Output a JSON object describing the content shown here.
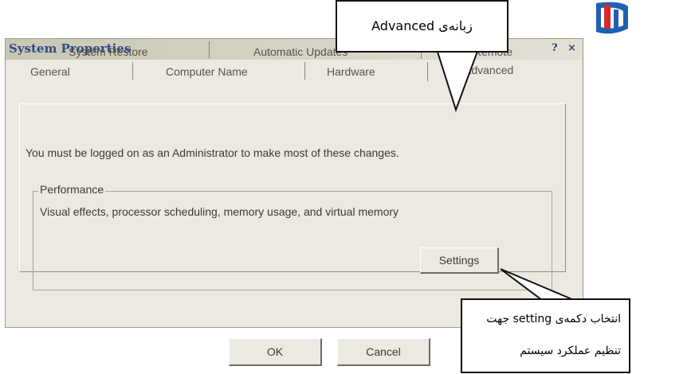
{
  "dialog": {
    "title": "System Properties",
    "help_button": "?",
    "close_button": "×",
    "tabs_back": [
      "System Restore",
      "Automatic Updates",
      "Remote"
    ],
    "tabs_front": [
      "General",
      "Computer Name",
      "Hardware",
      "Advanced"
    ],
    "active_tab": "Advanced",
    "intro_text": "You must be logged on as an Administrator to make most of these changes.",
    "performance": {
      "label": "Performance",
      "description": "Visual effects, processor scheduling, memory usage, and virtual memory",
      "settings_button": "Settings"
    },
    "ok_button": "OK",
    "cancel_button": "Cancel"
  },
  "annotations": {
    "tab_callout": "زبانه‌ی Advanced",
    "settings_callout_line1": "انتخاب دکمه‌ی setting جهت",
    "settings_callout_line2": "تنظیم عملکرد سیستم"
  },
  "colors": {
    "dialog_bg": "#ebe9e1",
    "title_text": "#2f4a86",
    "logo_blue": "#1f5fb4",
    "logo_red": "#d42a2a"
  }
}
